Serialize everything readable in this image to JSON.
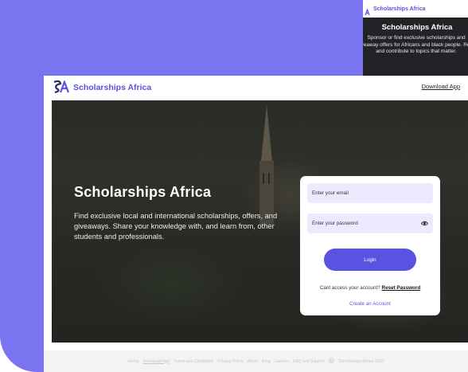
{
  "brand": {
    "name": "Scholarships Africa",
    "accent": "#5a52e0",
    "background": "#7b74f0"
  },
  "mobile_preview": {
    "brand_name": "Scholarships Africa",
    "title": "Scholarships Africa",
    "description": "Sponsor or find exclusive scholarships and giveaway offers for Africans and black people. Read and contribute to topics that matter."
  },
  "header": {
    "brand_name": "Scholarships Africa",
    "download_label": "Download App"
  },
  "hero": {
    "title": "Scholarships Africa",
    "description": "Find exclusive local and international scholarships, offers, and giveaways. Share your knowledge with, and learn from, other students and professionals."
  },
  "login": {
    "email_placeholder": "Enter your email",
    "password_placeholder": "Enter your password",
    "password_icon": "eye-icon",
    "login_label": "Login",
    "access_text": "Cant access your account?",
    "reset_label": "Reset Password",
    "create_label": "Create an Account"
  },
  "footer": {
    "items": [
      "Home",
      "Download App",
      "Terms and Conditions",
      "Privacy Policy",
      "About",
      "Blog",
      "Careers",
      "FAQ and Support",
      "Scholarships Africa 2020"
    ],
    "copyright_icon": "copyright-icon"
  }
}
